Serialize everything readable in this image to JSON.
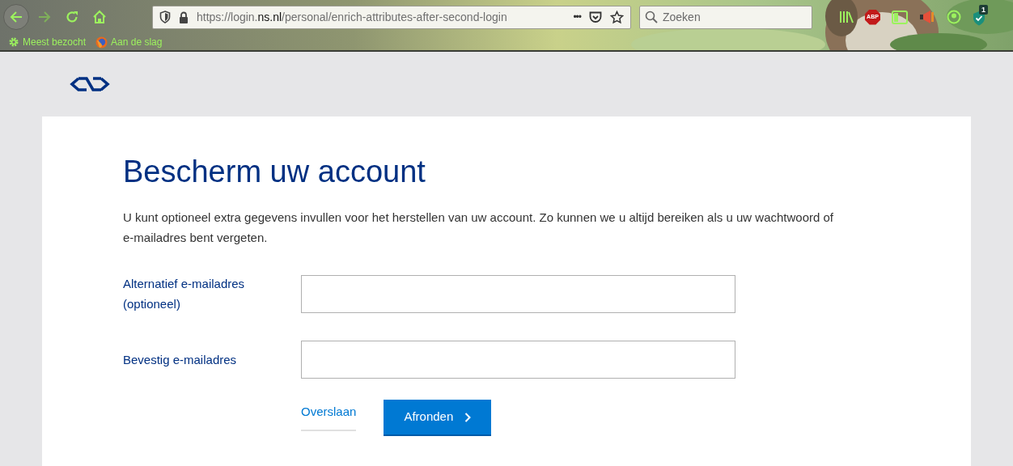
{
  "browser": {
    "url": {
      "prefix": "https://login.",
      "domain": "ns.nl",
      "path": "/personal/enrich-attributes-after-second-login"
    },
    "more_label": "•••",
    "search": {
      "placeholder": "Zoeken"
    },
    "abp_label": "ABP",
    "badge": "1",
    "bookmarks": [
      {
        "label": "Meest bezocht",
        "kind": "gear"
      },
      {
        "label": "Aan de slag",
        "kind": "globe"
      }
    ]
  },
  "page": {
    "title": "Bescherm uw account",
    "intro": "U kunt optioneel extra gegevens invullen voor het herstellen van uw account. Zo kunnen we u altijd bereiken als u uw wachtwoord of e-mailadres bent vergeten.",
    "fields": [
      {
        "label": "Alternatief e-mailadres (optioneel)"
      },
      {
        "label": "Bevestig e-mailadres"
      }
    ],
    "skip_link": "Overslaan",
    "submit_button": "Afronden"
  }
}
